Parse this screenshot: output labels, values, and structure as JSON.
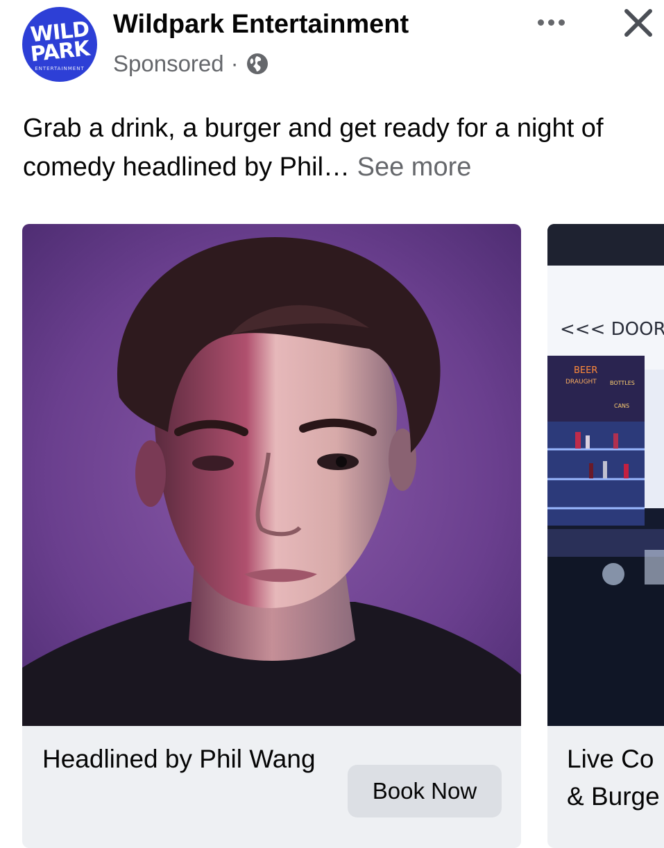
{
  "post": {
    "page_name": "Wildpark Entertainment",
    "sponsored_label": "Sponsored",
    "separator": "·",
    "audience_icon": "globe-icon",
    "caption": "Grab a drink, a burger and get ready for a night of comedy headlined by Phil…",
    "see_more": "See more",
    "more_icon": "more-horizontal-icon",
    "close_icon": "close-icon"
  },
  "logo": {
    "line1": "WILD",
    "line2": "PARK",
    "line3": "ENTERTAINMENT",
    "color": "#2d3fd6"
  },
  "carousel": {
    "cards": [
      {
        "title": "Headlined by Phil Wang",
        "cta": "Book Now"
      },
      {
        "title": "Live Co\n& Burge"
      }
    ],
    "card2_sign": "<<< DOOR",
    "card2_menu_heading": "BEER",
    "card2_menu_sub": "DRAUGHT",
    "card2_menu_bottles": "BOTTLES",
    "card2_menu_cans": "CANS"
  },
  "colors": {
    "secondary_text": "#65676b",
    "card_bg": "#eef0f3",
    "button_bg": "#dcdfe4"
  }
}
